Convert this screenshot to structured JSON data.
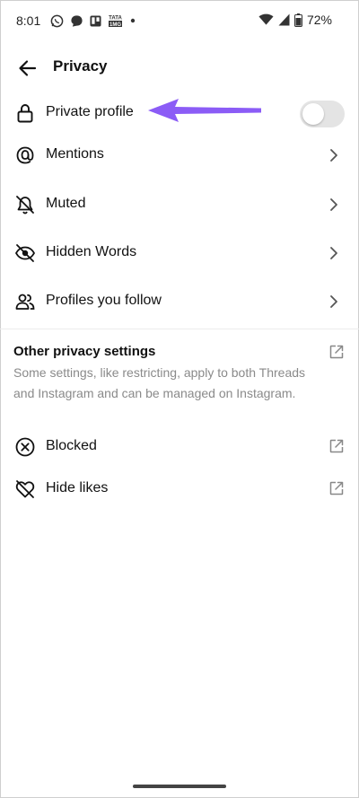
{
  "status_bar": {
    "time": "8:01",
    "battery": "72%",
    "icons": [
      "whatsapp-icon",
      "chat-icon",
      "trello-icon",
      "tata-icon",
      "dot-icon",
      "wifi-icon",
      "signal-icon",
      "battery-icon"
    ],
    "tata_text_top": "TATA",
    "tata_text_bottom": "1MG"
  },
  "header": {
    "title": "Privacy"
  },
  "rows": [
    {
      "label": "Private profile",
      "icon": "lock-icon",
      "control": "toggle",
      "toggle_on": false
    },
    {
      "label": "Mentions",
      "icon": "at-sign-icon",
      "control": "chevron"
    },
    {
      "label": "Muted",
      "icon": "bell-off-icon",
      "control": "chevron"
    },
    {
      "label": "Hidden Words",
      "icon": "eye-off-icon",
      "control": "chevron"
    },
    {
      "label": "Profiles you follow",
      "icon": "people-icon",
      "control": "chevron"
    }
  ],
  "other_section": {
    "title": "Other privacy settings",
    "description": "Some settings, like restricting, apply to both Threads and Instagram and can be managed on Instagram."
  },
  "external_rows": [
    {
      "label": "Blocked",
      "icon": "blocked-icon"
    },
    {
      "label": "Hide likes",
      "icon": "heart-off-icon"
    }
  ],
  "colors": {
    "accent_arrow": "#8b5cf6",
    "toggle_track": "#e4e4e4",
    "muted_text": "#8a8a8a"
  }
}
